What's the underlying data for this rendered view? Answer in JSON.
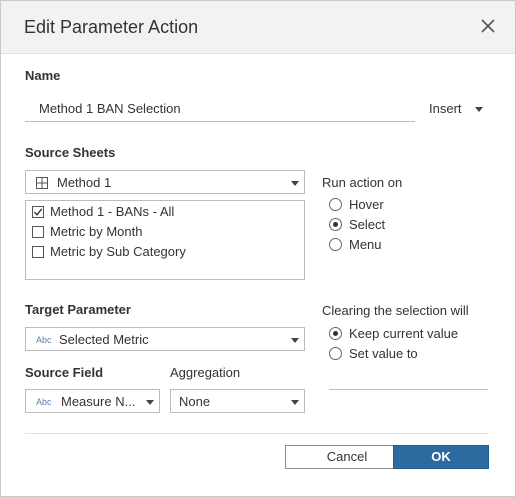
{
  "dialog": {
    "title": "Edit Parameter Action",
    "close_icon": "close-icon"
  },
  "name": {
    "label": "Name",
    "value": "Method 1 BAN Selection",
    "insert_label": "Insert"
  },
  "source_sheets": {
    "label": "Source Sheets",
    "selected": "Method 1",
    "icon": "worksheet-grid-icon",
    "items": [
      {
        "label": "Method 1 - BANs - All",
        "checked": true
      },
      {
        "label": "Metric by Month",
        "checked": false
      },
      {
        "label": "Metric by Sub Category",
        "checked": false
      }
    ]
  },
  "run_action": {
    "label": "Run action on",
    "options": [
      {
        "label": "Hover",
        "selected": false
      },
      {
        "label": "Select",
        "selected": true
      },
      {
        "label": "Menu",
        "selected": false
      }
    ]
  },
  "target_parameter": {
    "label": "Target Parameter",
    "type_tag": "Abc",
    "value": "Selected Metric"
  },
  "clearing": {
    "label": "Clearing the selection will",
    "options": [
      {
        "label": "Keep current value",
        "selected": true
      },
      {
        "label": "Set value to",
        "selected": false
      }
    ]
  },
  "source_field": {
    "label": "Source Field",
    "type_tag": "Abc",
    "value": "Measure N..."
  },
  "aggregation": {
    "label": "Aggregation",
    "value": "None"
  },
  "buttons": {
    "cancel": "Cancel",
    "ok": "OK"
  }
}
